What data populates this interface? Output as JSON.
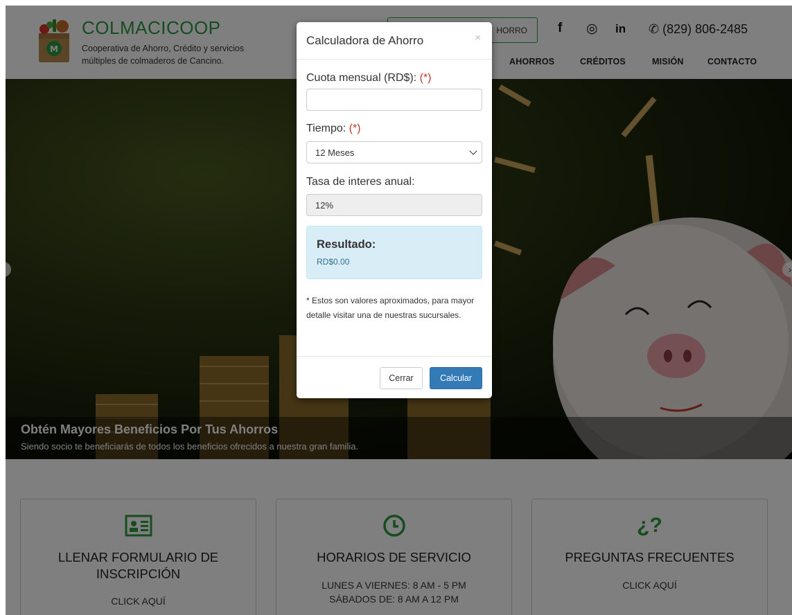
{
  "brand": {
    "name": "COLMACICOOP",
    "tagline": "Cooperativa de Ahorro, Crédito y servicios múltiples de colmaderos de Cancino."
  },
  "header": {
    "cta_partial": "HORRO",
    "social": [
      "f",
      "◎",
      "in"
    ],
    "phone": "✆ (829) 806-2485",
    "nav": [
      "AHORROS",
      "CRÉDITOS",
      "MISIÓN",
      "CONTACTO"
    ]
  },
  "hero": {
    "title": "Obtén Mayores Beneficios Por Tus Ahorros",
    "subtitle": "Siendo socio te beneficiarás de todos los beneficios ofrecidos a nuestra gran familia."
  },
  "cards": [
    {
      "title": "LLENAR FORMULARIO DE INSCRIPCIÓN",
      "line1": "CLICK AQUÍ",
      "icon": "id-card-icon"
    },
    {
      "title": "HORARIOS DE SERVICIO",
      "line1": "LUNES A VIERNES: 8 AM - 5 PM",
      "line2": "SÁBADOS DE: 8 AM A 12 PM",
      "icon": "clock-icon"
    },
    {
      "title": "PREGUNTAS FRECUENTES",
      "line1": "CLICK AQUÍ",
      "icon": "question-icon"
    }
  ],
  "modal": {
    "title": "Calculadora de Ahorro",
    "close": "×",
    "cuota_label": "Cuota mensual (RD$):",
    "required_mark": "(*)",
    "cuota_value": "",
    "tiempo_label": "Tiempo:",
    "tiempo_value": "12 Meses",
    "tasa_label": "Tasa de interes anual:",
    "tasa_value": "12%",
    "result_label": "Resultado:",
    "result_value": "RD$0.00",
    "note": "* Estos son valores aproximados, para mayor detalle visitar una de nuestras sucursales.",
    "cancel": "Cerrar",
    "submit": "Calcular"
  },
  "colors": {
    "brand_green": "#2a9a3f",
    "primary_blue": "#337ab7",
    "required_red": "#c0392b"
  }
}
